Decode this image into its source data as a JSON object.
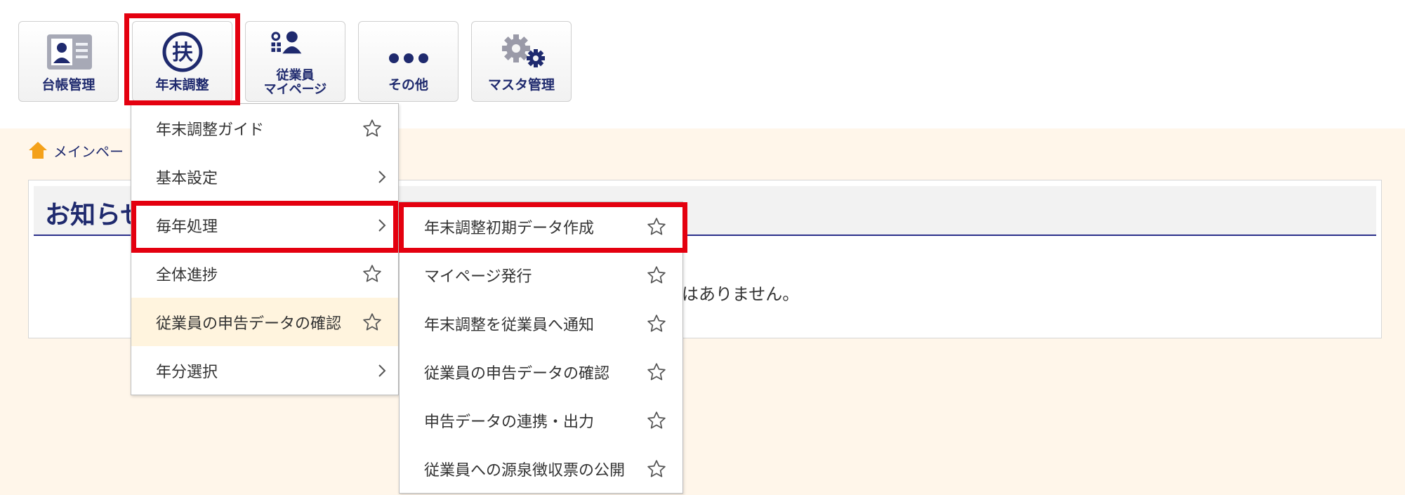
{
  "nav": {
    "ledger_label": "台帳管理",
    "yearend_label": "年末調整",
    "yearend_icon_char": "扶",
    "mypage_label_1": "従業員",
    "mypage_label_2": "マイページ",
    "mypage_icon_label": "従業員",
    "other_label": "その他",
    "master_label": "マスタ管理"
  },
  "breadcrumb": {
    "home_label": "メインペー"
  },
  "notice": {
    "title": "お知らせ",
    "message": "はありません。"
  },
  "menu_primary": [
    {
      "label": "年末調整ガイド",
      "indicator": "star"
    },
    {
      "label": "基本設定",
      "indicator": "arrow"
    },
    {
      "label": "毎年処理",
      "indicator": "arrow"
    },
    {
      "label": "全体進捗",
      "indicator": "star"
    },
    {
      "label": "従業員の申告データの確認",
      "indicator": "star"
    },
    {
      "label": "年分選択",
      "indicator": "arrow"
    }
  ],
  "menu_secondary": [
    {
      "label": "年末調整初期データ作成",
      "indicator": "star"
    },
    {
      "label": "マイページ発行",
      "indicator": "star"
    },
    {
      "label": "年末調整を従業員へ通知",
      "indicator": "star"
    },
    {
      "label": "従業員の申告データの確認",
      "indicator": "star"
    },
    {
      "label": "申告データの連携・出力",
      "indicator": "star"
    },
    {
      "label": "従業員への源泉徴収票の公開",
      "indicator": "star"
    }
  ],
  "colors": {
    "nav_text": "#1f2a6e",
    "highlight_red": "#e4000f",
    "content_bg": "#fff6ea",
    "hover_row_bg": "#fff4de",
    "icon_gray": "#9a9aa8"
  }
}
